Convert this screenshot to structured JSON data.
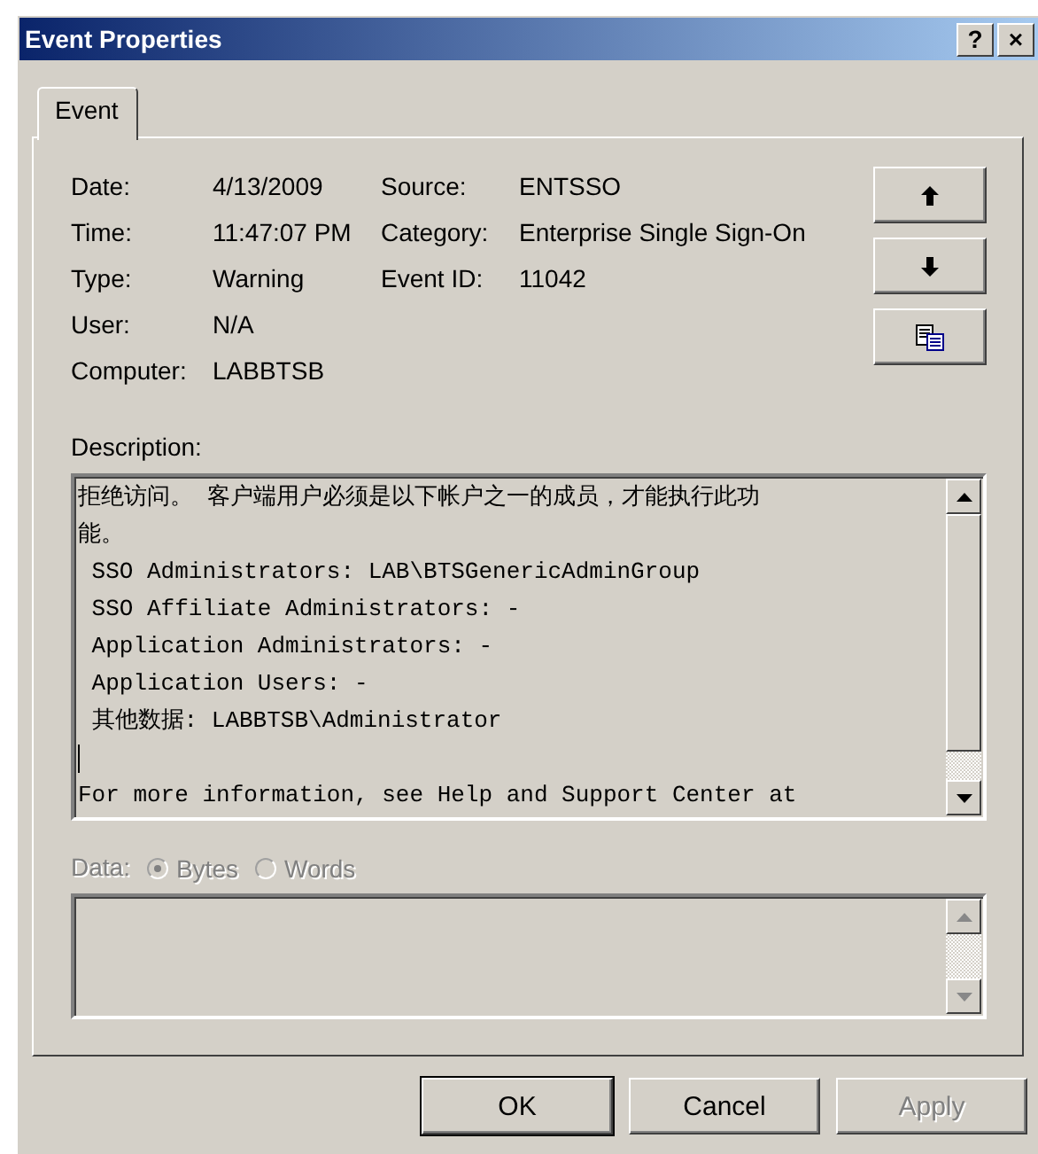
{
  "window": {
    "title": "Event Properties",
    "title_buttons": [
      "?",
      "×"
    ]
  },
  "tabs": [
    {
      "label": "Event",
      "selected": true
    }
  ],
  "fields": [
    {
      "label": "Date:",
      "value": "4/13/2009"
    },
    {
      "label": "Time:",
      "value": "11:47:07 PM"
    },
    {
      "label": "Type:",
      "value": "Warning"
    },
    {
      "label": "User:",
      "value": "N/A"
    },
    {
      "label": "Computer:",
      "value": "LABBTSB"
    }
  ],
  "fields_right": [
    {
      "label": "Source:",
      "value": "ENTSSO"
    },
    {
      "label": "Category:",
      "value": "Enterprise Single Sign-On"
    },
    {
      "label": "Event ID:",
      "value": "11042"
    }
  ],
  "side_buttons": [
    {
      "kind": "up"
    },
    {
      "kind": "down"
    },
    {
      "kind": "copy"
    }
  ],
  "description": {
    "label": "Description:",
    "lines": [
      "拒绝访问。 客户端用户必须是以下帐户之一的成员，才能执行此功",
      "能。",
      " SSO Administrators: LAB\\BTSGenericAdminGroup",
      " SSO Affiliate Administrators: -",
      " Application Administrators: -",
      " Application Users: -",
      " 其他数据: LABBTSB\\Administrator",
      "For more information, see Help and Support Center at"
    ]
  },
  "data": {
    "label": "Data:",
    "disabled": true,
    "options": [
      {
        "label": "Bytes",
        "selected": true
      },
      {
        "label": "Words",
        "selected": false
      }
    ]
  },
  "buttons": [
    {
      "label": "OK",
      "default": true,
      "disabled": false
    },
    {
      "label": "Cancel",
      "default": false,
      "disabled": false
    },
    {
      "label": "Apply",
      "default": false,
      "disabled": true
    }
  ]
}
